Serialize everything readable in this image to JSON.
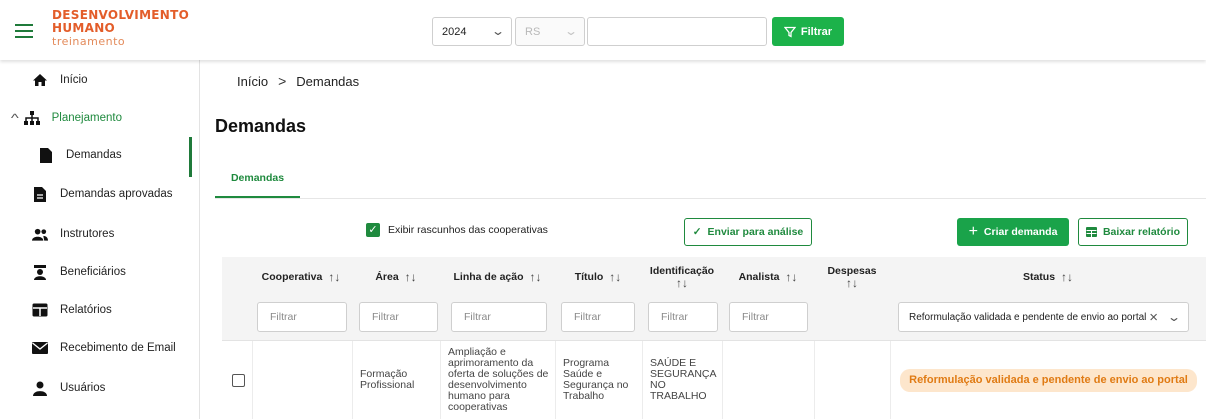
{
  "header": {
    "logo_line1": "DESENVOLVIMENTO",
    "logo_line2": "HUMANO",
    "logo_line3": "treinamento",
    "year_value": "2024",
    "uf_value": "RS",
    "search_value": "",
    "filter_button": "Filtrar"
  },
  "sidebar": {
    "items": [
      {
        "label": "Início",
        "icon": "home-icon"
      },
      {
        "label": "Planejamento",
        "icon": "sitemap-icon"
      },
      {
        "label": "Demandas",
        "icon": "file-icon"
      },
      {
        "label": "Demandas aprovadas",
        "icon": "file-icon"
      },
      {
        "label": "Instrutores",
        "icon": "users-icon"
      },
      {
        "label": "Beneficiários",
        "icon": "beneficiary-icon"
      },
      {
        "label": "Relatórios",
        "icon": "table-icon"
      },
      {
        "label": "Recebimento de Email",
        "icon": "envelope-icon"
      },
      {
        "label": "Usuários",
        "icon": "user-icon"
      }
    ]
  },
  "breadcrumb": {
    "home": "Início",
    "separator": ">",
    "current": "Demandas"
  },
  "page_title": "Demandas",
  "tabs": [
    {
      "label": "Demandas"
    }
  ],
  "toolbar": {
    "show_drafts_label": "Exibir rascunhos das cooperativas",
    "send_label": "Enviar para análise",
    "create_label": "Criar demanda",
    "report_label": "Baixar relatório"
  },
  "table": {
    "columns": [
      "Cooperativa",
      "Área",
      "Linha de ação",
      "Título",
      "Identificação",
      "Analista",
      "Despesas",
      "Status"
    ],
    "filter_placeholder": "Filtrar",
    "status_filter_value": "Reformulação validada e pendente de envio ao portal",
    "rows": [
      {
        "cooperativa": "",
        "area": "Formação Profissional",
        "linha_acao": "Ampliação e aprimoramento da oferta de soluções de desenvolvimento humano para cooperativas",
        "titulo": "Programa Saúde e Segurança no Trabalho",
        "identificacao": "SAÚDE E SEGURANÇA NO TRABALHO",
        "analista": "",
        "despesas": "",
        "status": "Reformulação validada e pendente de envio ao portal"
      }
    ]
  },
  "colors": {
    "brand_green": "#1f8a3e",
    "logo_orange": "#e35d2a",
    "status_badge_bg": "#fde6cc",
    "status_badge_text": "#e07b14"
  }
}
